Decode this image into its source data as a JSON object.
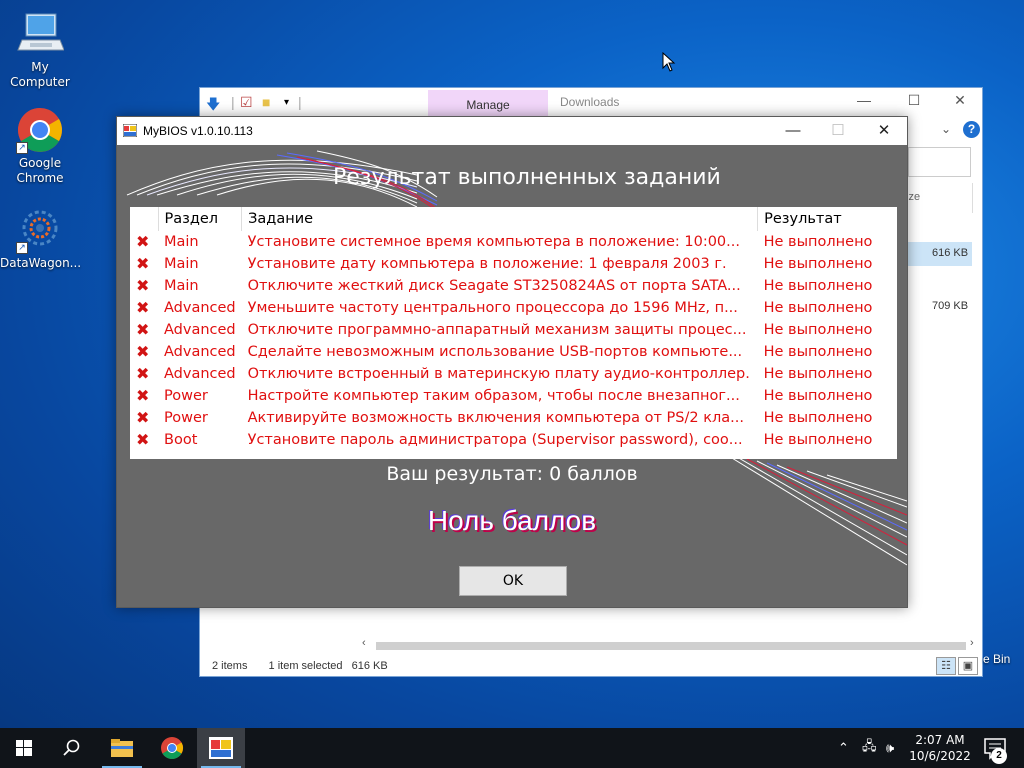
{
  "desktop": {
    "icons": [
      {
        "label": "My Computer"
      },
      {
        "label": "Google\nChrome"
      },
      {
        "label": "DataWagon..."
      }
    ],
    "recycle_bin_label": "e Bin"
  },
  "explorer": {
    "manage_tab": "Manage",
    "location": "Downloads",
    "size_header": "ize",
    "file_sizes": [
      "616 KB",
      "709 KB"
    ],
    "status": {
      "items": "2 items",
      "selected": "1 item selected",
      "size": "616 KB"
    }
  },
  "bios_window": {
    "title": "MyBIOS v1.0.10.113",
    "heading": "Результат выполненных заданий",
    "columns": {
      "section": "Раздел",
      "task": "Задание",
      "result": "Результат"
    },
    "rows": [
      {
        "section": "Main",
        "task": "Установите системное время компьютера в положение: 10:00...",
        "result": "Не выполнено"
      },
      {
        "section": "Main",
        "task": "Установите дату компьютера в положение: 1 февраля 2003 г.",
        "result": "Не выполнено"
      },
      {
        "section": "Main",
        "task": "Отключите жесткий диск Seagate ST3250824AS от порта SATA...",
        "result": "Не выполнено"
      },
      {
        "section": "Advanced",
        "task": "Уменьшите частоту центрального процессора до 1596 MHz, п...",
        "result": "Не выполнено"
      },
      {
        "section": "Advanced",
        "task": "Отключите программно-аппаратный механизм защиты процес...",
        "result": "Не выполнено"
      },
      {
        "section": "Advanced",
        "task": "Сделайте невозможным использование USB-портов компьюте...",
        "result": "Не выполнено"
      },
      {
        "section": "Advanced",
        "task": "Отключите встроенный в материнскую плату аудио-контроллер.",
        "result": "Не выполнено"
      },
      {
        "section": "Power",
        "task": "Настройте компьютер таким образом, чтобы после внезапног...",
        "result": "Не выполнено"
      },
      {
        "section": "Power",
        "task": "Активируйте возможность включения компьютера от PS/2 кла...",
        "result": "Не выполнено"
      },
      {
        "section": "Boot",
        "task": "Установите пароль администратора (Supervisor password), соо...",
        "result": "Не выполнено"
      }
    ],
    "score_text": "Ваш результат: 0 баллов",
    "verdict": "Ноль баллов",
    "ok_label": "OK"
  },
  "taskbar": {
    "time": "2:07 AM",
    "date": "10/6/2022",
    "notification_count": "2"
  },
  "colors": {
    "failed_red": "#e01010",
    "bios_bg": "#686868",
    "desktop_blue": "#0b63c7"
  }
}
